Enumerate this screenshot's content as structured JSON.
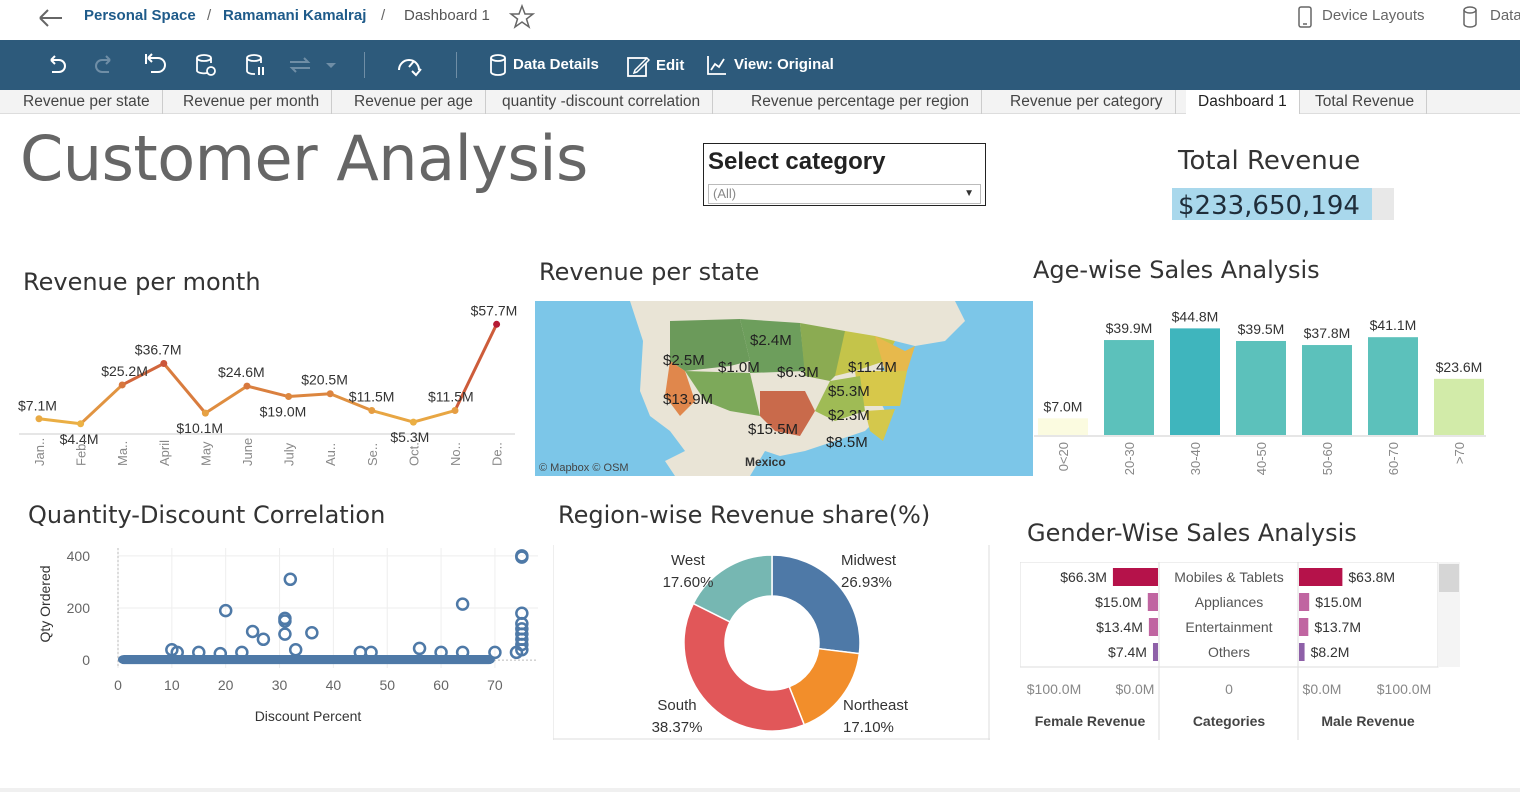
{
  "breadcrumb": {
    "space": "Personal Space",
    "user": "Ramamani Kamalraj",
    "current": "Dashboard 1",
    "sep": "/"
  },
  "topright": {
    "device_layouts": "Device Layouts",
    "data": "Data"
  },
  "toolbar": {
    "data_details": "Data Details",
    "edit": "Edit",
    "view": "View: Original"
  },
  "tabs": [
    "Revenue per state",
    "Revenue per month",
    "Revenue per age",
    "quantity -discount correlation",
    "Revenue percentage per region",
    "Revenue per category",
    "Dashboard 1",
    "Total Revenue"
  ],
  "dashboard": {
    "title": "Customer Analysis",
    "filter_label": "Select category",
    "filter_value": "(All)",
    "kpi_title": "Total Revenue",
    "kpi_value": "$233,650,194",
    "kpi_fill": 0.9
  },
  "colors": {
    "toolbar": "#2d5a7b",
    "kpi_fill": "#a9d8ec",
    "female": "#b5124a",
    "male": "#b5124a"
  },
  "chart_data": [
    {
      "id": "month",
      "type": "line",
      "title": "Revenue per month",
      "categories": [
        "Jan..",
        "Feb..",
        "Ma..",
        "April",
        "May",
        "June",
        "July",
        "Au..",
        "Se..",
        "Oct..",
        "No..",
        "De.."
      ],
      "values": [
        7.1,
        4.4,
        25.2,
        36.7,
        10.1,
        24.6,
        19.0,
        20.5,
        11.5,
        5.3,
        11.5,
        57.7
      ],
      "labels": [
        "$7.1M",
        "$4.4M",
        "$25.2M",
        "$36.7M",
        "$10.1M",
        "$24.6M",
        "$19.0M",
        "$20.5M",
        "$11.5M",
        "$5.3M",
        "$11.5M",
        "$57.7M"
      ],
      "ylim": [
        0,
        60
      ]
    },
    {
      "id": "state",
      "type": "map",
      "title": "Revenue per state",
      "labels": [
        "$2.4M",
        "$2.5M",
        "$1.0M",
        "$6.3M",
        "$11.4M",
        "$13.9M",
        "$5.3M",
        "$2.3M",
        "$15.5M",
        "$8.5M"
      ],
      "country_label": "Mexico",
      "attribution": "© Mapbox  © OSM"
    },
    {
      "id": "age",
      "type": "bar",
      "title": "Age-wise Sales Analysis",
      "categories": [
        "0<20",
        "20-30",
        "30-40",
        "40-50",
        "50-60",
        "60-70",
        ">70"
      ],
      "values": [
        7.0,
        39.9,
        44.8,
        39.5,
        37.8,
        41.1,
        23.6
      ],
      "labels": [
        "$7.0M",
        "$39.9M",
        "$44.8M",
        "$39.5M",
        "$37.8M",
        "$41.1M",
        "$23.6M"
      ],
      "colors": [
        "#fbfbe0",
        "#5cc1bb",
        "#3fb5bd",
        "#5cc1bb",
        "#5cc1bb",
        "#5cc1bb",
        "#d2eba9"
      ],
      "ylim": [
        0,
        50
      ]
    },
    {
      "id": "scatter",
      "type": "scatter",
      "title": "Quantity-Discount Correlation",
      "xlabel": "Discount Percent",
      "ylabel": "Qty Ordered",
      "xticks": [
        0,
        10,
        20,
        30,
        40,
        50,
        60,
        70
      ],
      "yticks": [
        0,
        200,
        400
      ],
      "xlim": [
        0,
        78
      ],
      "ylim": [
        -30,
        430
      ],
      "points": [
        [
          75,
          400
        ],
        [
          75,
          395
        ],
        [
          32,
          310
        ],
        [
          20,
          190
        ],
        [
          31,
          160
        ],
        [
          31,
          150
        ],
        [
          64,
          215
        ],
        [
          25,
          110
        ],
        [
          31,
          100
        ],
        [
          36,
          105
        ],
        [
          27,
          80
        ],
        [
          75,
          180
        ],
        [
          75,
          140
        ],
        [
          75,
          120
        ],
        [
          75,
          100
        ],
        [
          75,
          80
        ],
        [
          75,
          60
        ],
        [
          75,
          40
        ],
        [
          10,
          40
        ],
        [
          11,
          30
        ],
        [
          15,
          30
        ],
        [
          19,
          25
        ],
        [
          23,
          30
        ],
        [
          33,
          40
        ],
        [
          45,
          30
        ],
        [
          47,
          30
        ],
        [
          56,
          45
        ],
        [
          60,
          30
        ],
        [
          64,
          30
        ],
        [
          70,
          30
        ],
        [
          74,
          30
        ]
      ]
    },
    {
      "id": "region",
      "type": "pie",
      "title": "Region-wise Revenue share(%)",
      "slices": [
        {
          "name": "Midwest",
          "label": "26.93%",
          "value": 26.93,
          "color": "#4e79a7"
        },
        {
          "name": "Northeast",
          "label": "17.10%",
          "value": 17.1,
          "color": "#f28e2b"
        },
        {
          "name": "South",
          "label": "38.37%",
          "value": 38.37,
          "color": "#e15759"
        },
        {
          "name": "West",
          "label": "17.60%",
          "value": 17.6,
          "color": "#76b7b2"
        }
      ]
    },
    {
      "id": "gender",
      "type": "bar",
      "title": "Gender-Wise Sales Analysis",
      "categories": [
        "Mobiles & Tablets",
        "Appliances",
        "Entertainment",
        "Others"
      ],
      "female": [
        66.3,
        15.0,
        13.4,
        7.4
      ],
      "female_labels": [
        "$66.3M",
        "$15.0M",
        "$13.4M",
        "$7.4M"
      ],
      "male": [
        63.8,
        15.0,
        13.7,
        8.2
      ],
      "male_labels": [
        "$63.8M",
        "$15.0M",
        "$13.7M",
        "$8.2M"
      ],
      "colors": [
        "#b5124a",
        "#c065a1",
        "#c065a1",
        "#8e60a8"
      ],
      "female_axis": [
        "$100.0M",
        "$0.0M"
      ],
      "center_axis": "0",
      "male_axis": [
        "$0.0M",
        "$100.0M"
      ],
      "female_title": "Female Revenue",
      "center_title": "Categories",
      "male_title": "Male Revenue",
      "xlim": [
        0,
        100
      ]
    }
  ]
}
